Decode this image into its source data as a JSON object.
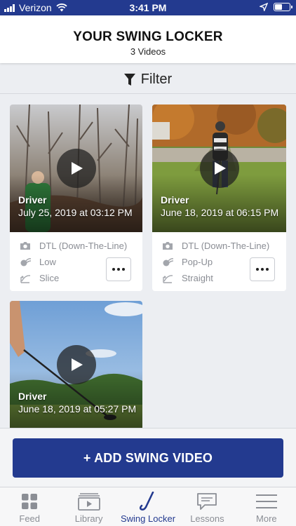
{
  "status_bar": {
    "carrier": "Verizon",
    "time": "3:41 PM",
    "battery_level": 0.55
  },
  "header": {
    "title": "YOUR SWING LOCKER",
    "subtitle": "3 Videos"
  },
  "filter": {
    "label": "Filter"
  },
  "videos": [
    {
      "club": "Driver",
      "date": "July 25, 2019 at 03:12 PM",
      "view": "DTL (Down-The-Line)",
      "trajectory": "Low",
      "shape": "Slice",
      "show_details": true
    },
    {
      "club": "Driver",
      "date": "June 18, 2019 at 06:15 PM",
      "view": "DTL (Down-The-Line)",
      "trajectory": "Pop-Up",
      "shape": "Straight",
      "show_details": true
    },
    {
      "club": "Driver",
      "date": "June 18, 2019 at 05:27 PM",
      "show_details": false
    }
  ],
  "add_button": {
    "label": "+ ADD SWING VIDEO"
  },
  "tabs": [
    {
      "label": "Feed",
      "icon": "grid-icon",
      "active": false
    },
    {
      "label": "Library",
      "icon": "library-icon",
      "active": false
    },
    {
      "label": "Swing Locker",
      "icon": "golf-club-icon",
      "active": true
    },
    {
      "label": "Lessons",
      "icon": "chat-icon",
      "active": false
    },
    {
      "label": "More",
      "icon": "menu-icon",
      "active": false
    }
  ],
  "colors": {
    "brand": "#233a8f",
    "background": "#eceef2",
    "inactive": "#8b8e95"
  }
}
